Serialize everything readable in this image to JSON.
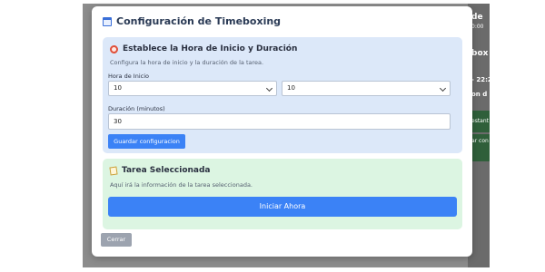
{
  "background": {
    "texts": [
      "de",
      "0:00",
      "box",
      "- 22:2",
      "on d",
      "estant",
      "ar con"
    ]
  },
  "modal": {
    "title": "Configuración de Timeboxing",
    "icon": "calendar-icon",
    "close_label": "Cerrar"
  },
  "schedule_section": {
    "title": "Establece la Hora de Inicio y Duración",
    "icon": "alarm-clock-icon",
    "subtitle": "Configura la hora de inicio y la duración de la tarea.",
    "start_label": "Hora de Inicio",
    "hour_value": "10",
    "minute_value": "10",
    "duration_label": "Duración (minutos)",
    "duration_value": "30",
    "save_label": "Guardar configuracion"
  },
  "task_section": {
    "title": "Tarea Seleccionada",
    "icon": "memo-icon",
    "subtitle": "Aquí irá la información de la tarea seleccionada.",
    "start_label": "Iniciar Ahora"
  },
  "colors": {
    "primary": "#3b82f6",
    "blue_section": "#dce8f9",
    "green_section": "#dcf5e2",
    "close_button": "#9ca3af"
  }
}
